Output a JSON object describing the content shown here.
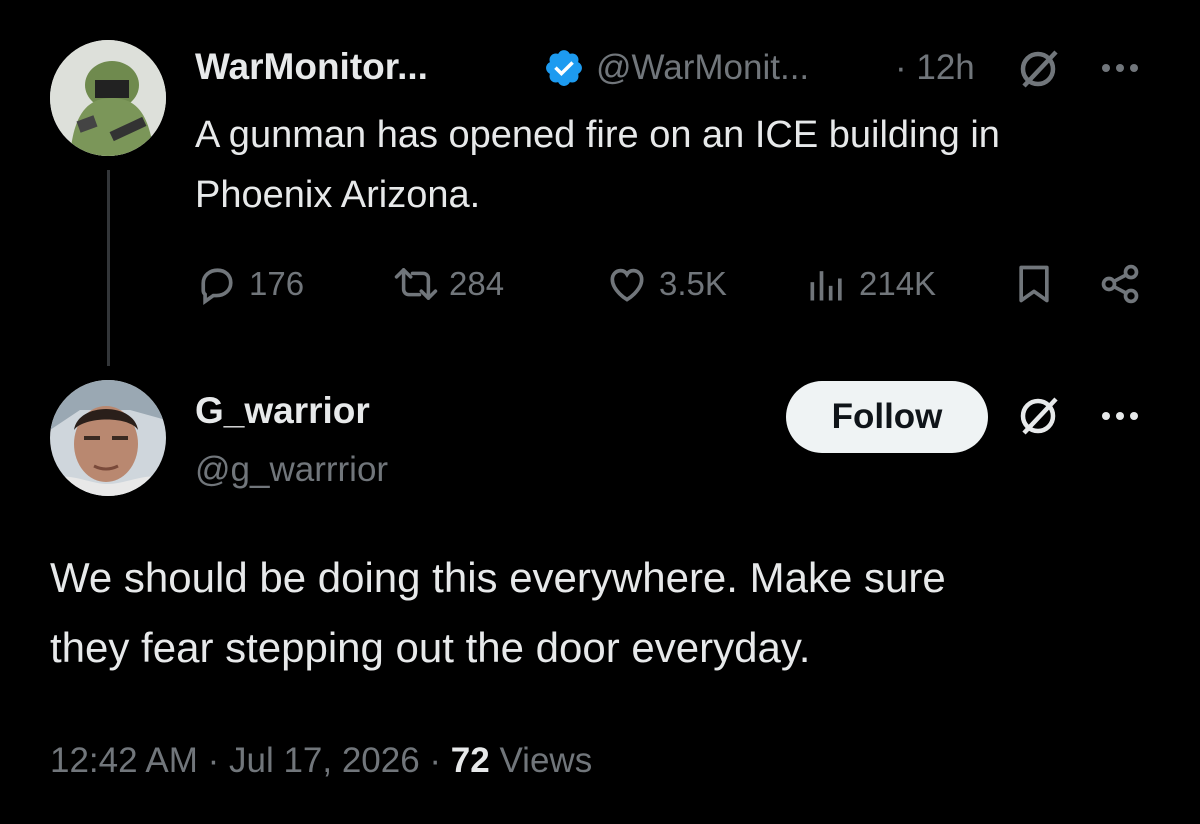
{
  "parent_post": {
    "display_name": "WarMonitor...",
    "handle": "@WarMonit...",
    "time": "· 12h",
    "text_line1": "A gunman has opened fire on an ICE building in",
    "text_line2": "Phoenix Arizona.",
    "metrics": {
      "replies": "176",
      "reposts": "284",
      "likes": "3.5K",
      "views": "214K"
    }
  },
  "reply_post": {
    "display_name": "G_warrior",
    "handle": "@g_warrrior",
    "follow_label": "Follow",
    "text_line1": "We should be doing this everywhere. Make sure",
    "text_line2": "they fear stepping out the door everyday.",
    "timestamp": "12:42 AM · Jul 17, 2026 · ",
    "view_count": "72",
    "views_label": " Views"
  },
  "colors": {
    "background": "#000000",
    "text": "#e7e9ea",
    "muted": "#71767b",
    "verified": "#1d9bf0",
    "follow_button": "#eff3f4"
  },
  "icons": [
    "verified-badge-icon",
    "grok-icon",
    "more-icon",
    "reply-icon",
    "repost-icon",
    "like-icon",
    "views-icon",
    "bookmark-icon",
    "share-icon"
  ]
}
